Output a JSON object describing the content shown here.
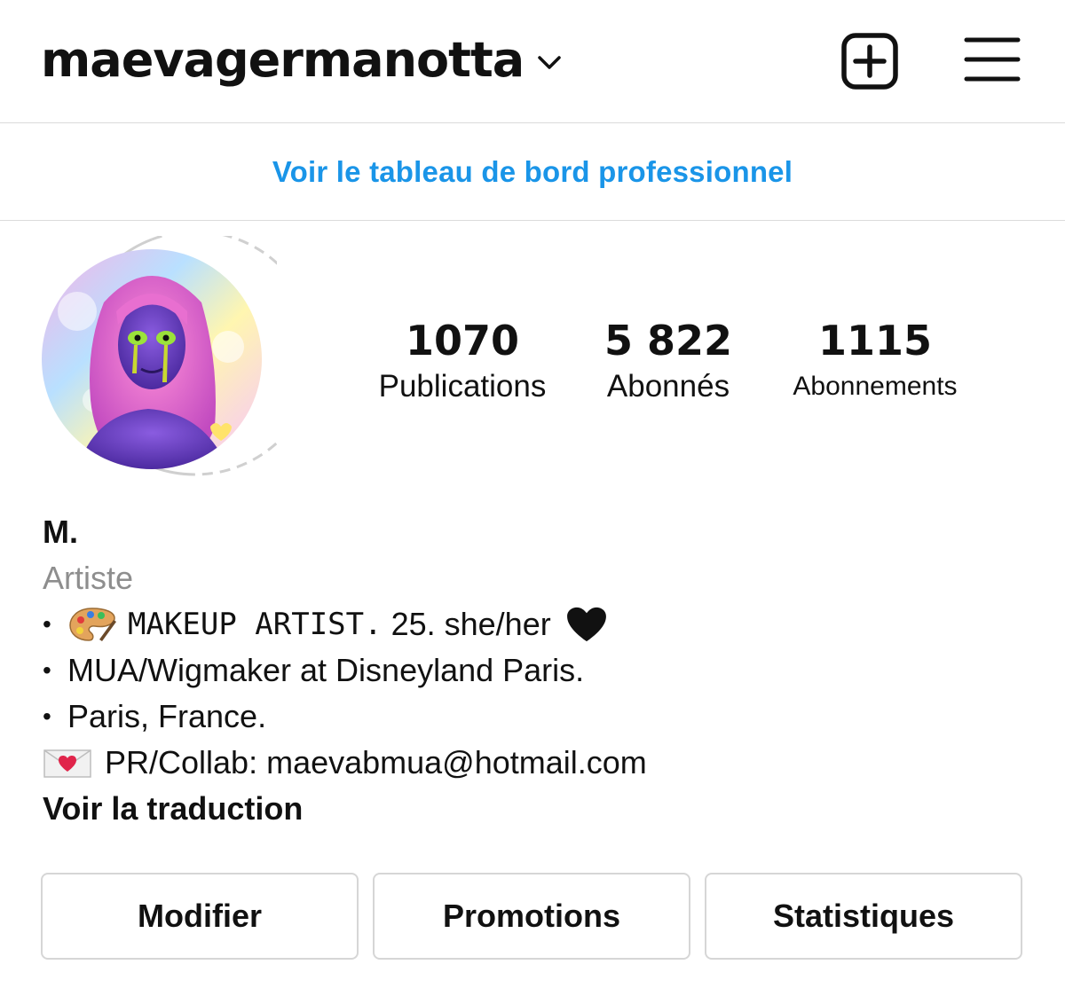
{
  "header": {
    "username": "maevagermanotta",
    "chevron_icon": "chevron-down-icon",
    "new_post_icon": "plus-square-icon",
    "menu_icon": "hamburger-menu-icon"
  },
  "dashboard_link": "Voir le tableau de bord professionnel",
  "stats": [
    {
      "value": "1070",
      "label": "Publications"
    },
    {
      "value": "5 822",
      "label": "Abonnés"
    },
    {
      "value": "1115",
      "label": "Abonnements"
    }
  ],
  "bio": {
    "name": "M.",
    "category": "Artiste",
    "line1_bullet": "•",
    "line1_mono": "MAKEUP ARTIST.",
    "line1_rest": "25. she/her",
    "line2_bullet": "•",
    "line2_text": "MUA/Wigmaker at Disneyland Paris.",
    "line3_bullet": "•",
    "line3_text": "Paris, France.",
    "line4_text": "PR/Collab: maevabmua@hotmail.com",
    "translate_link": "Voir la traduction"
  },
  "buttons": {
    "edit": "Modifier",
    "promotions": "Promotions",
    "insights": "Statistiques"
  },
  "colors": {
    "link_blue": "#1a95e8",
    "muted_gray": "#8e8e8e",
    "divider": "#dbdbdb"
  }
}
